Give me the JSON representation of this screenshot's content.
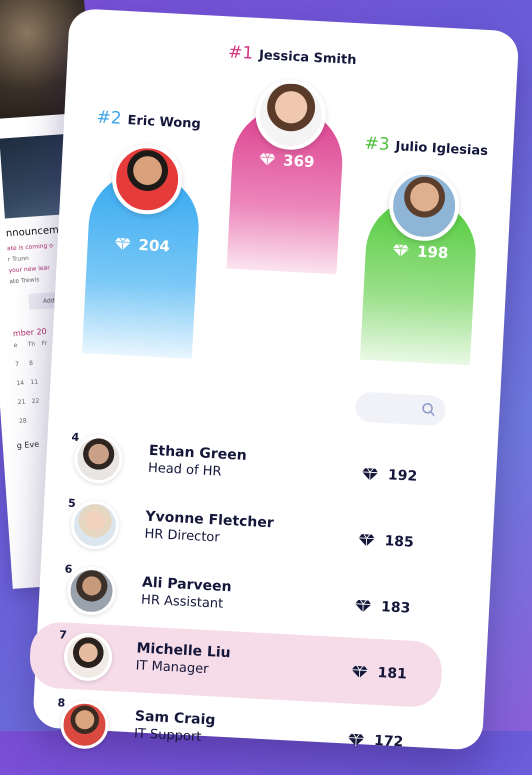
{
  "background": {
    "announcements_heading": "nnouncem",
    "lines": [
      "ate is coming o",
      "r Trunn",
      "your new lear",
      "ate Trewis"
    ],
    "button_label": "Add",
    "month_label": "mber 20",
    "weekday_labels": [
      "e",
      "Th",
      "Fr"
    ],
    "calendar_numbers": [
      "7",
      "8",
      "14",
      "11",
      "21",
      "22",
      "28"
    ],
    "footer_text": "g Eve"
  },
  "leaderboard": {
    "podium": [
      {
        "rank": "#1",
        "name": "Jessica Smith",
        "points": "369",
        "color": "#d4357f"
      },
      {
        "rank": "#2",
        "name": "Eric Wong",
        "points": "204",
        "color": "#3fa6ea"
      },
      {
        "rank": "#3",
        "name": "Julio Iglesias",
        "points": "198",
        "color": "#4fbf3c"
      }
    ],
    "list": [
      {
        "position": "4",
        "name": "Ethan Green",
        "title": "Head of HR",
        "points": "192"
      },
      {
        "position": "5",
        "name": "Yvonne Fletcher",
        "title": "HR Director",
        "points": "185"
      },
      {
        "position": "6",
        "name": "Ali Parveen",
        "title": "HR Assistant",
        "points": "183"
      },
      {
        "position": "7",
        "name": "Michelle Liu",
        "title": "IT Manager",
        "points": "181"
      },
      {
        "position": "8",
        "name": "Sam Craig",
        "title": "IT Support",
        "points": "172"
      }
    ],
    "highlight_color": "#f6dbe8",
    "search_icon": "search-icon",
    "points_icon": "diamond-icon"
  }
}
